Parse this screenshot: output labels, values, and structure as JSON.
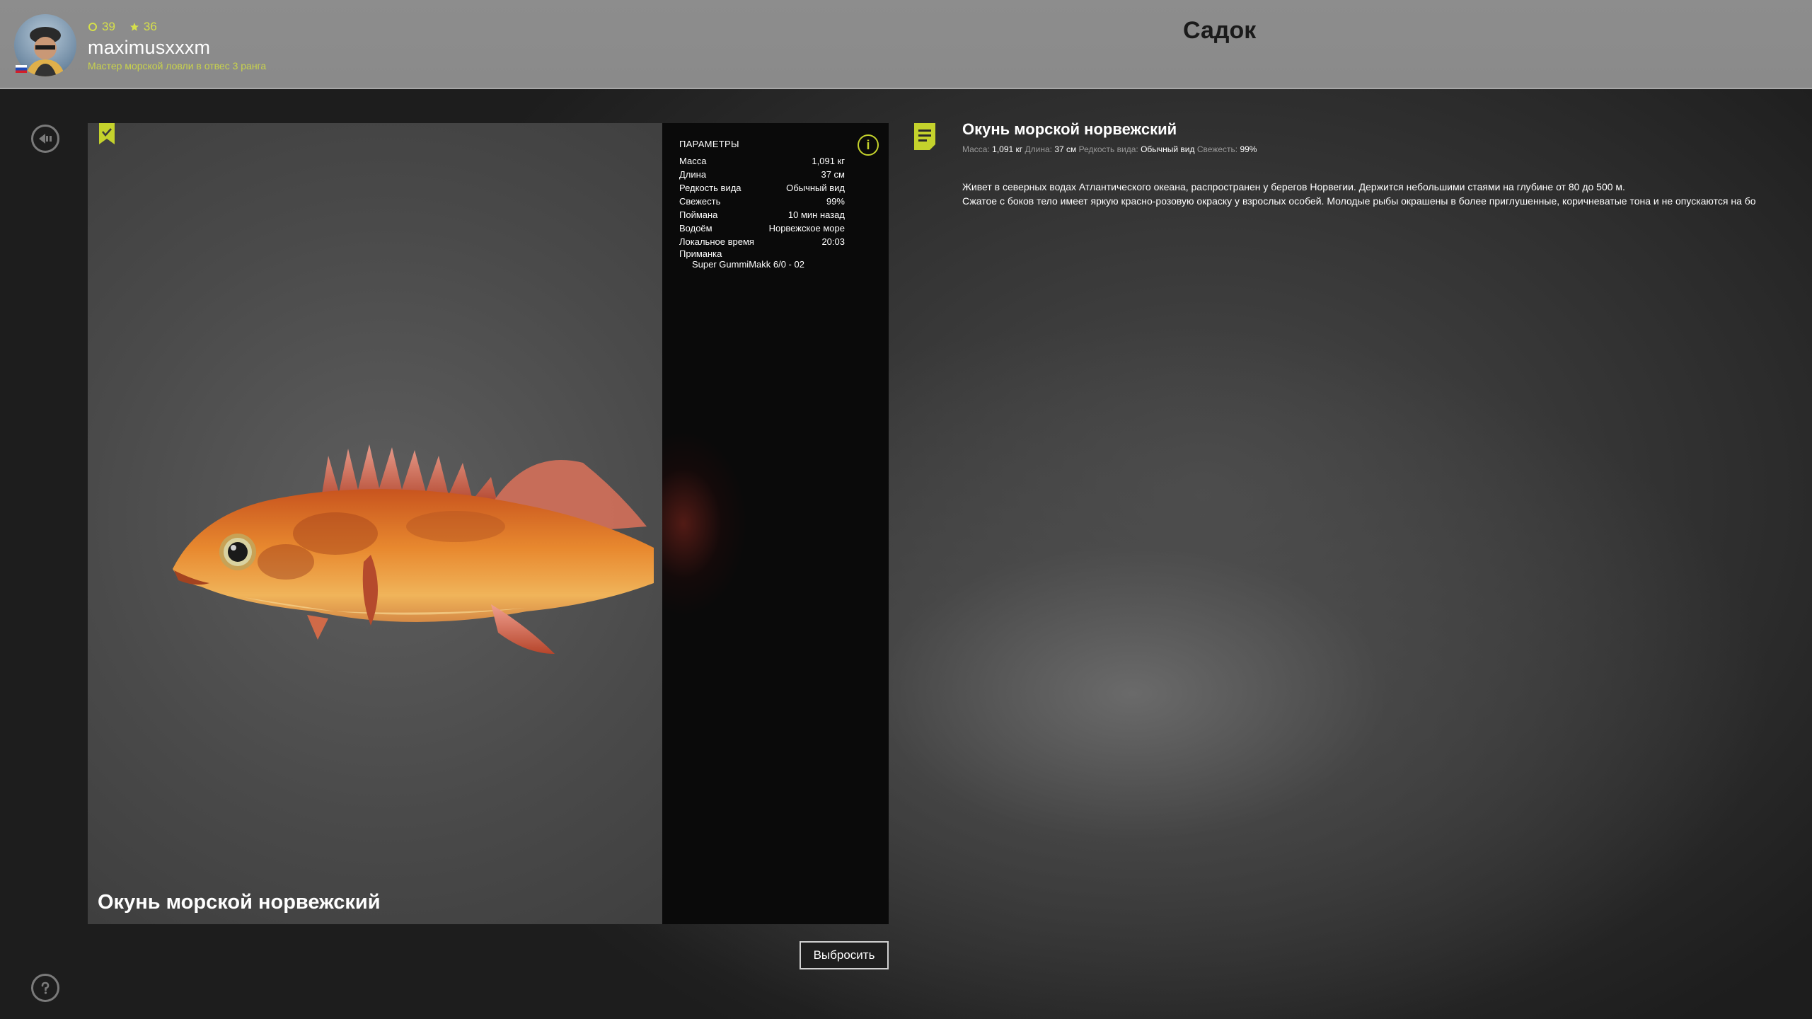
{
  "header": {
    "coins": "39",
    "stars": "36",
    "username": "maximusxxxm",
    "rank": "Мастер морской ловли в отвес 3 ранга",
    "title": "Садок"
  },
  "fish": {
    "name": "Окунь морской норвежский"
  },
  "params": {
    "title": "ПАРАМЕТРЫ",
    "rows": [
      {
        "label": "Масса",
        "value": "1,091 кг"
      },
      {
        "label": "Длина",
        "value": "37 см"
      },
      {
        "label": "Редкость вида",
        "value": "Обычный вид"
      },
      {
        "label": "Свежесть",
        "value": "99%"
      },
      {
        "label": "Поймана",
        "value": "10 мин назад"
      },
      {
        "label": "Водоём",
        "value": "Норвежское море"
      },
      {
        "label": "Локальное время",
        "value": "20:03"
      }
    ],
    "bait_label": "Приманка",
    "bait_value": "Super GummiMakk 6/0 - 02"
  },
  "actions": {
    "discard": "Выбросить"
  },
  "description": {
    "title": "Окунь морской норвежский",
    "meta": {
      "mass_label": "Масса:",
      "mass_value": "1,091 кг",
      "length_label": "Длина:",
      "length_value": "37 см",
      "rarity_label": "Редкость вида:",
      "rarity_value": "Обычный вид",
      "fresh_label": "Свежесть:",
      "fresh_value": "99%"
    },
    "line1": "Живет в северных водах Атлантического океана, распространен у берегов Норвегии. Держится небольшими стаями на глубине от 80 до 500 м.",
    "line2": "Сжатое с боков тело имеет яркую красно-розовую окраску у взрослых особей. Молодые рыбы окрашены в более приглушенные, коричневатые тона и не опускаются на бо"
  },
  "icons": {
    "back": "back-arrow-icon",
    "help": "help-icon",
    "info": "info-icon",
    "document": "document-icon",
    "bookmark": "bookmark-check-icon"
  },
  "colors": {
    "accent": "#c4d22c",
    "header_bg": "#8d8d8d",
    "params_bg": "#0a0a0a"
  }
}
